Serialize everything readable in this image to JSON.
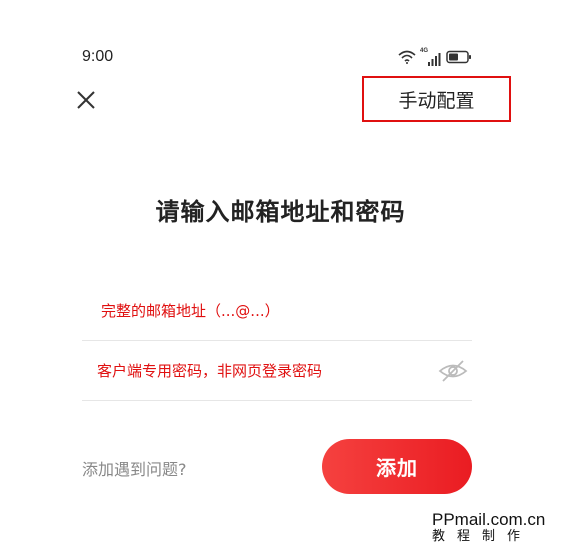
{
  "status_bar": {
    "time": "9:00",
    "network_label": "4G",
    "icons": [
      "wifi-icon",
      "signal-icon",
      "battery-icon"
    ]
  },
  "header": {
    "close_icon": "close-icon",
    "manual_config_label": "手动配置"
  },
  "main": {
    "title": "请输入邮箱地址和密码",
    "email_placeholder": "完整的邮箱地址（...@...）",
    "password_placeholder": "客户端专用密码，非网页登录密码",
    "password_toggle_icon": "eye-off-icon"
  },
  "footer": {
    "help_label": "添加遇到问题?",
    "add_button_label": "添加"
  },
  "watermark": {
    "url": "PPmail.com.cn",
    "subtitle": "教程制作"
  },
  "colors": {
    "accent": "#ea1c22",
    "highlight_border": "#e01010",
    "placeholder": "#e01010",
    "help_text": "#888888"
  }
}
